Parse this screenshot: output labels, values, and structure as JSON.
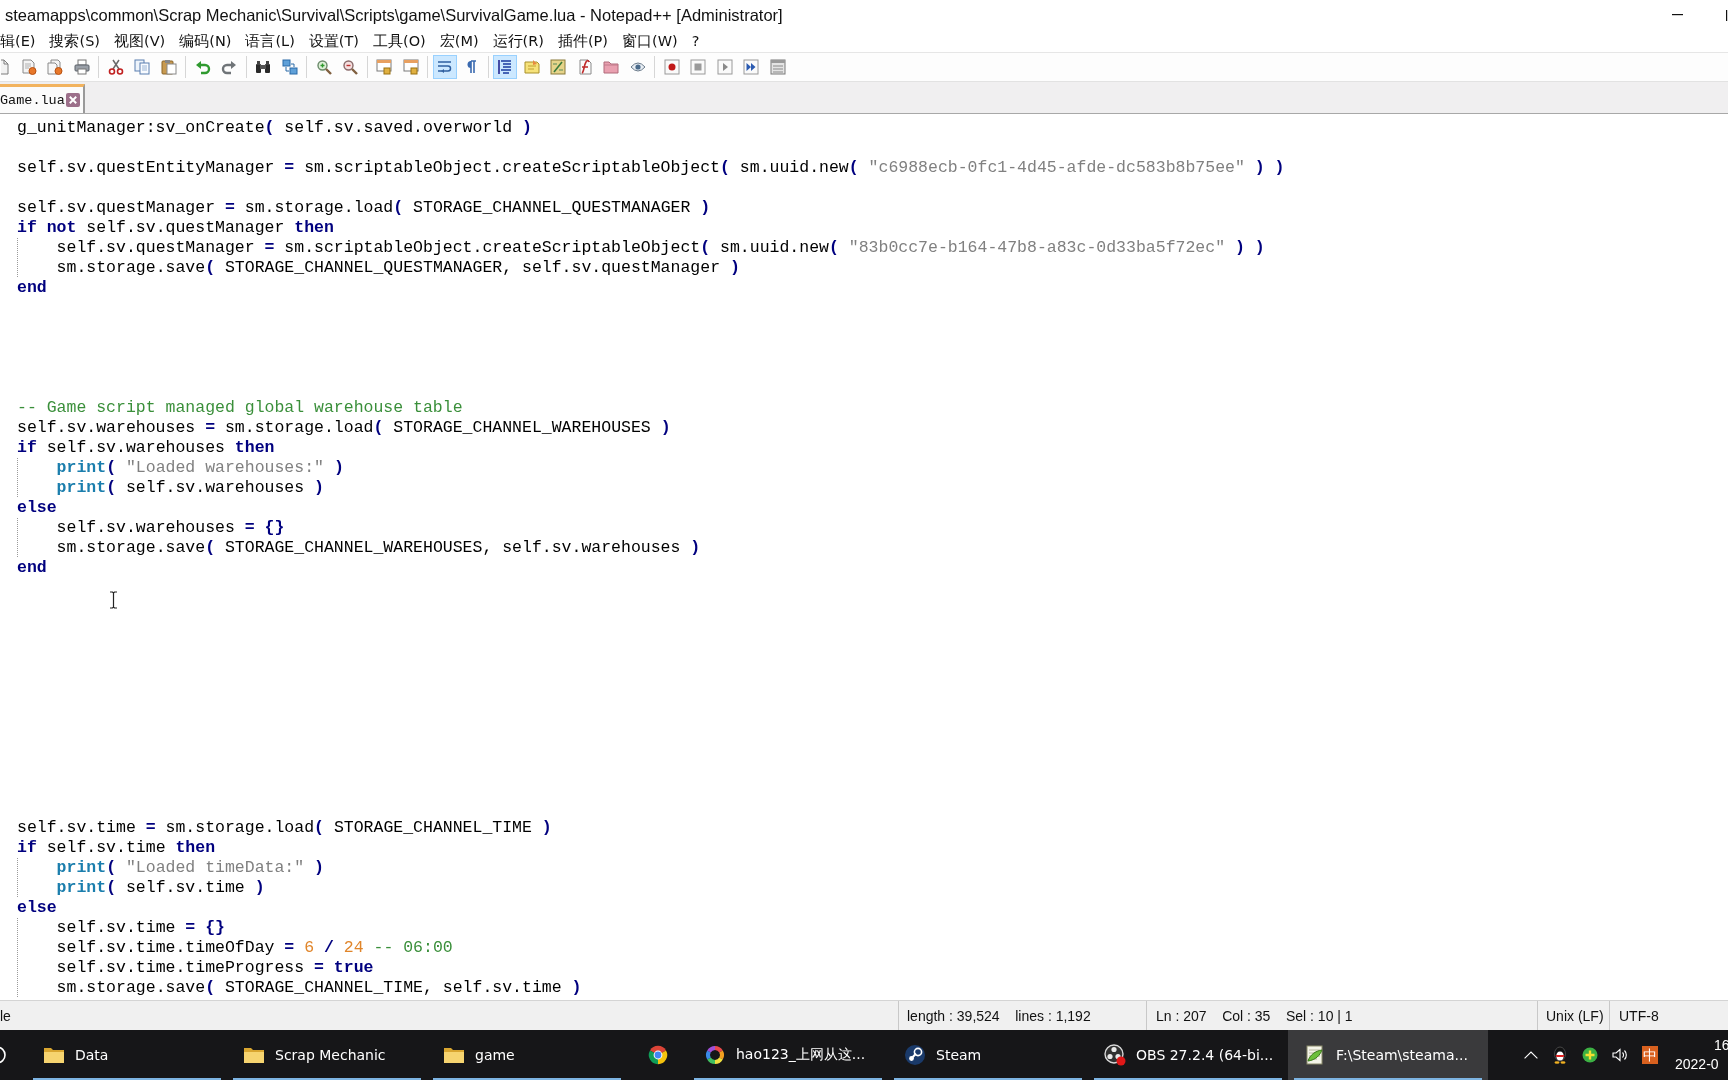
{
  "window": {
    "title": "steamapps\\common\\Scrap Mechanic\\Survival\\Scripts\\game\\SurvivalGame.lua - Notepad++ [Administrator]"
  },
  "menu": [
    "辑(E)",
    "搜索(S)",
    "视图(V)",
    "编码(N)",
    "语言(L)",
    "设置(T)",
    "工具(O)",
    "宏(M)",
    "运行(R)",
    "插件(P)",
    "窗口(W)",
    "?"
  ],
  "toolbar": {
    "groups": [
      {
        "buttons": [
          {
            "pressed": false
          },
          {
            "pressed": false
          },
          {
            "pressed": false
          },
          {
            "pressed": false
          }
        ]
      },
      {
        "buttons": [
          {
            "pressed": false
          },
          {
            "pressed": false
          },
          {
            "pressed": false
          }
        ]
      },
      {
        "buttons": [
          {
            "pressed": false
          },
          {
            "pressed": false
          }
        ]
      },
      {
        "buttons": [
          {
            "pressed": false
          },
          {
            "pressed": false
          }
        ]
      },
      {
        "buttons": [
          {
            "pressed": false
          },
          {
            "pressed": false
          }
        ]
      },
      {
        "buttons": [
          {
            "pressed": false
          },
          {
            "pressed": false
          }
        ]
      },
      {
        "buttons": [
          {
            "pressed": true
          },
          {
            "pressed": false
          }
        ]
      },
      {
        "buttons": [
          {
            "pressed": true
          },
          {
            "pressed": false
          },
          {
            "pressed": false
          },
          {
            "pressed": false
          },
          {
            "pressed": false
          },
          {
            "pressed": false
          }
        ]
      },
      {
        "buttons": [
          {
            "pressed": false
          },
          {
            "pressed": false
          },
          {
            "pressed": false
          },
          {
            "pressed": false
          },
          {
            "pressed": false
          }
        ]
      }
    ]
  },
  "tabs": [
    {
      "label": "Game.lua",
      "selected": true
    }
  ],
  "editor": {
    "lines": [
      {
        "kind": "code",
        "tokens": [
          {
            "kind": "text",
            "text": "g_unitManager:sv_onCreate"
          },
          {
            "kind": "operator",
            "text": "("
          },
          {
            "kind": "text",
            "text": " self.sv.saved.overworld "
          },
          {
            "kind": "operator",
            "text": ")"
          }
        ]
      },
      {
        "kind": "blank"
      },
      {
        "kind": "code",
        "tokens": [
          {
            "kind": "text",
            "text": "self.sv.questEntityManager "
          },
          {
            "kind": "operator",
            "text": "="
          },
          {
            "kind": "text",
            "text": " sm.scriptableObject.createScriptableObject"
          },
          {
            "kind": "operator",
            "text": "("
          },
          {
            "kind": "text",
            "text": " sm.uuid.new"
          },
          {
            "kind": "operator",
            "text": "( "
          },
          {
            "kind": "string",
            "text": "\"c6988ecb-0fc1-4d45-afde-dc583b8b75ee\""
          },
          {
            "kind": "operator",
            "text": " ) )"
          }
        ]
      },
      {
        "kind": "blank"
      },
      {
        "kind": "code",
        "tokens": [
          {
            "kind": "text",
            "text": "self.sv.questManager "
          },
          {
            "kind": "operator",
            "text": "="
          },
          {
            "kind": "text",
            "text": " sm.storage.load"
          },
          {
            "kind": "operator",
            "text": "("
          },
          {
            "kind": "text",
            "text": " STORAGE_CHANNEL_QUESTMANAGER "
          },
          {
            "kind": "operator",
            "text": ")"
          }
        ]
      },
      {
        "kind": "code",
        "tokens": [
          {
            "kind": "keyword",
            "text": "if not"
          },
          {
            "kind": "text",
            "text": " self.sv.questManager "
          },
          {
            "kind": "keyword",
            "text": "then"
          }
        ]
      },
      {
        "kind": "code",
        "tokens": [
          {
            "kind": "text",
            "text": "    self.sv.questManager "
          },
          {
            "kind": "operator",
            "text": "="
          },
          {
            "kind": "text",
            "text": " sm.scriptableObject.createScriptableObject"
          },
          {
            "kind": "operator",
            "text": "("
          },
          {
            "kind": "text",
            "text": " sm.uuid.new"
          },
          {
            "kind": "operator",
            "text": "( "
          },
          {
            "kind": "string",
            "text": "\"83b0cc7e-b164-47b8-a83c-0d33ba5f72ec\""
          },
          {
            "kind": "operator",
            "text": " ) )"
          }
        ]
      },
      {
        "kind": "code",
        "tokens": [
          {
            "kind": "text",
            "text": "    sm.storage.save"
          },
          {
            "kind": "operator",
            "text": "("
          },
          {
            "kind": "text",
            "text": " STORAGE_CHANNEL_QUESTMANAGER, self.sv.questManager "
          },
          {
            "kind": "operator",
            "text": ")"
          }
        ]
      },
      {
        "kind": "code",
        "tokens": [
          {
            "kind": "keyword",
            "text": "end"
          }
        ]
      },
      {
        "kind": "blank"
      },
      {
        "kind": "blank"
      },
      {
        "kind": "blank"
      },
      {
        "kind": "blank"
      },
      {
        "kind": "blank"
      },
      {
        "kind": "code",
        "tokens": [
          {
            "kind": "comment",
            "text": "-- Game script managed global warehouse table"
          }
        ]
      },
      {
        "kind": "code",
        "tokens": [
          {
            "kind": "text",
            "text": "self.sv.warehouses "
          },
          {
            "kind": "operator",
            "text": "="
          },
          {
            "kind": "text",
            "text": " sm.storage.load"
          },
          {
            "kind": "operator",
            "text": "("
          },
          {
            "kind": "text",
            "text": " STORAGE_CHANNEL_WAREHOUSES "
          },
          {
            "kind": "operator",
            "text": ")"
          }
        ]
      },
      {
        "kind": "code",
        "tokens": [
          {
            "kind": "keyword",
            "text": "if"
          },
          {
            "kind": "text",
            "text": " self.sv.warehouses "
          },
          {
            "kind": "keyword",
            "text": "then"
          }
        ]
      },
      {
        "kind": "code",
        "tokens": [
          {
            "kind": "function",
            "text": "    print"
          },
          {
            "kind": "operator",
            "text": "( "
          },
          {
            "kind": "string",
            "text": "\"Loaded warehouses:\""
          },
          {
            "kind": "operator",
            "text": " )"
          }
        ]
      },
      {
        "kind": "code",
        "tokens": [
          {
            "kind": "function",
            "text": "    print"
          },
          {
            "kind": "operator",
            "text": "("
          },
          {
            "kind": "text",
            "text": " self.sv.warehouses "
          },
          {
            "kind": "operator",
            "text": ")"
          }
        ]
      },
      {
        "kind": "code",
        "tokens": [
          {
            "kind": "keyword",
            "text": "else"
          }
        ]
      },
      {
        "kind": "code",
        "tokens": [
          {
            "kind": "text",
            "text": "    self.sv.warehouses "
          },
          {
            "kind": "operator",
            "text": "= {}"
          }
        ]
      },
      {
        "kind": "code",
        "tokens": [
          {
            "kind": "text",
            "text": "    sm.storage.save"
          },
          {
            "kind": "operator",
            "text": "("
          },
          {
            "kind": "text",
            "text": " STORAGE_CHANNEL_WAREHOUSES, self.sv.warehouses "
          },
          {
            "kind": "operator",
            "text": ")"
          }
        ]
      },
      {
        "kind": "code",
        "tokens": [
          {
            "kind": "keyword",
            "text": "end"
          }
        ]
      },
      {
        "kind": "blank"
      },
      {
        "kind": "blank"
      },
      {
        "kind": "blank"
      },
      {
        "kind": "blank"
      },
      {
        "kind": "blank"
      },
      {
        "kind": "blank"
      },
      {
        "kind": "blank"
      },
      {
        "kind": "blank"
      },
      {
        "kind": "blank"
      },
      {
        "kind": "blank"
      },
      {
        "kind": "blank"
      },
      {
        "kind": "blank"
      },
      {
        "kind": "code",
        "tokens": [
          {
            "kind": "text",
            "text": "self.sv.time "
          },
          {
            "kind": "operator",
            "text": "="
          },
          {
            "kind": "text",
            "text": " sm.storage.load"
          },
          {
            "kind": "operator",
            "text": "("
          },
          {
            "kind": "text",
            "text": " STORAGE_CHANNEL_TIME "
          },
          {
            "kind": "operator",
            "text": ")"
          }
        ]
      },
      {
        "kind": "code",
        "tokens": [
          {
            "kind": "keyword",
            "text": "if"
          },
          {
            "kind": "text",
            "text": " self.sv.time "
          },
          {
            "kind": "keyword",
            "text": "then"
          }
        ]
      },
      {
        "kind": "code",
        "tokens": [
          {
            "kind": "function",
            "text": "    print"
          },
          {
            "kind": "operator",
            "text": "( "
          },
          {
            "kind": "string",
            "text": "\"Loaded timeData:\""
          },
          {
            "kind": "operator",
            "text": " )"
          }
        ]
      },
      {
        "kind": "code",
        "tokens": [
          {
            "kind": "function",
            "text": "    print"
          },
          {
            "kind": "operator",
            "text": "("
          },
          {
            "kind": "text",
            "text": " self.sv.time "
          },
          {
            "kind": "operator",
            "text": ")"
          }
        ]
      },
      {
        "kind": "code",
        "tokens": [
          {
            "kind": "keyword",
            "text": "else"
          }
        ]
      },
      {
        "kind": "code",
        "tokens": [
          {
            "kind": "text",
            "text": "    self.sv.time "
          },
          {
            "kind": "operator",
            "text": "= {}"
          }
        ]
      },
      {
        "kind": "code",
        "tokens": [
          {
            "kind": "text",
            "text": "    self.sv.time.timeOfDay "
          },
          {
            "kind": "operator",
            "text": "= "
          },
          {
            "kind": "number",
            "text": "6"
          },
          {
            "kind": "operator",
            "text": " / "
          },
          {
            "kind": "number",
            "text": "24"
          },
          {
            "kind": "comment",
            "text": " -- 06:00"
          }
        ]
      },
      {
        "kind": "code",
        "tokens": [
          {
            "kind": "text",
            "text": "    self.sv.time.timeProgress "
          },
          {
            "kind": "operator",
            "text": "="
          },
          {
            "kind": "keyword",
            "text": " true"
          }
        ]
      },
      {
        "kind": "code",
        "tokens": [
          {
            "kind": "text",
            "text": "    sm.storage.save"
          },
          {
            "kind": "operator",
            "text": "("
          },
          {
            "kind": "text",
            "text": " STORAGE_CHANNEL_TIME, self.sv.time "
          },
          {
            "kind": "operator",
            "text": ")"
          }
        ]
      }
    ]
  },
  "status_bar": {
    "fields": [
      "le",
      "length : 39,524    lines : 1,192",
      "Ln : 207    Col : 35    Sel : 10 | 1",
      "Unix (LF)",
      "UTF-8"
    ]
  },
  "taskbar": {
    "items": [
      {
        "label": "Data",
        "selected": false,
        "running": true
      },
      {
        "label": "Scrap Mechanic",
        "selected": false,
        "running": true
      },
      {
        "label": "game",
        "selected": false,
        "running": true
      },
      {
        "selected": false,
        "running": false
      },
      {
        "label": "hao123_上网从这...",
        "selected": false,
        "running": true
      },
      {
        "label": "Steam",
        "selected": false,
        "running": true
      },
      {
        "label": "OBS 27.2.4 (64-bi...",
        "selected": false,
        "running": true
      },
      {
        "label": "F:\\Steam\\steama...",
        "selected": true,
        "running": true
      }
    ],
    "tray": {
      "input_mode": "中",
      "time": "16",
      "date": "2022-0"
    }
  }
}
